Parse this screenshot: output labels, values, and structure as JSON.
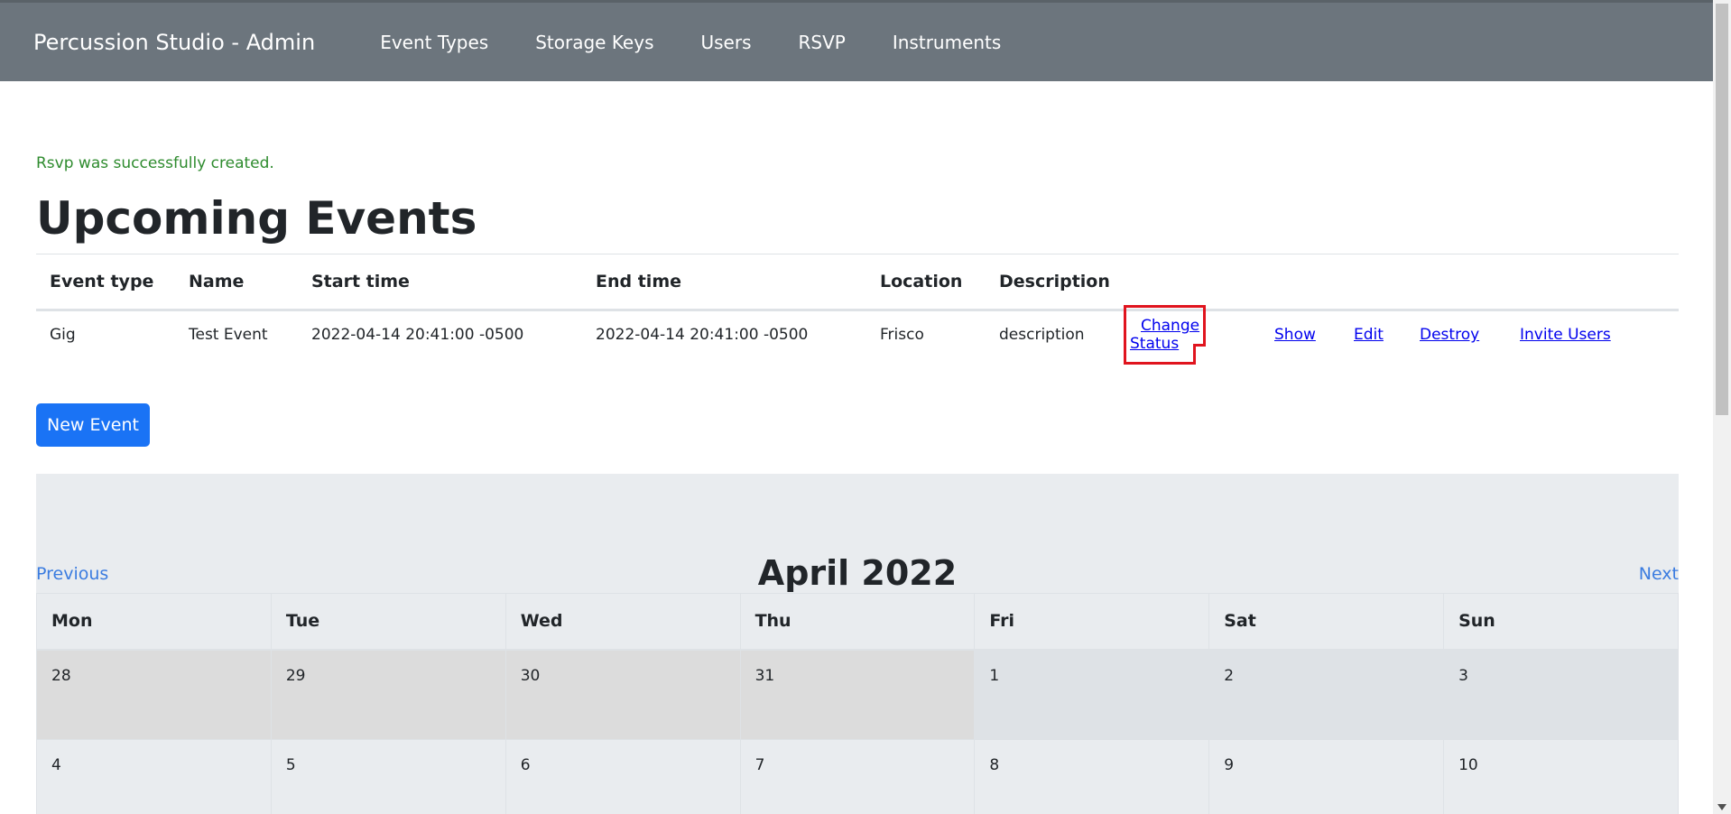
{
  "navbar": {
    "brand": "Percussion Studio - Admin",
    "links": [
      "Event Types",
      "Storage Keys",
      "Users",
      "RSVP",
      "Instruments"
    ]
  },
  "notice": "Rsvp was successfully created.",
  "page_title": "Upcoming Events",
  "events_table": {
    "headers": [
      "Event type",
      "Name",
      "Start time",
      "End time",
      "Location",
      "Description"
    ],
    "rows": [
      {
        "event_type": "Gig",
        "name": "Test Event",
        "start_time": "2022-04-14 20:41:00 -0500",
        "end_time": "2022-04-14 20:41:00 -0500",
        "location": "Frisco",
        "description": "description",
        "actions": [
          "Change Status",
          "Show",
          "Edit",
          "Destroy",
          "Invite Users"
        ]
      }
    ]
  },
  "new_event_label": "New Event",
  "calendar": {
    "previous_label": "Previous",
    "next_label": "Next",
    "title": "April 2022",
    "weekdays": [
      "Mon",
      "Tue",
      "Wed",
      "Thu",
      "Fri",
      "Sat",
      "Sun"
    ],
    "weeks": [
      [
        "28",
        "29",
        "30",
        "31",
        "1",
        "2",
        "3"
      ],
      [
        "4",
        "5",
        "6",
        "7",
        "8",
        "9",
        "10"
      ]
    ]
  },
  "colors": {
    "navbar": "#6c757d",
    "primary_button": "#1a73f5",
    "notice": "#2e8b2e",
    "link": "#0000ee",
    "highlight": "#e0141e"
  }
}
